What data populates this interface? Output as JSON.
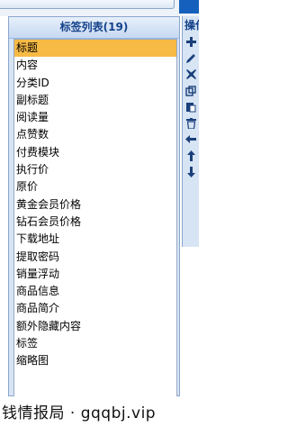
{
  "panel": {
    "title": "标签列表(19)",
    "items": [
      {
        "label": "标题",
        "selected": true
      },
      {
        "label": "内容"
      },
      {
        "label": "分类ID"
      },
      {
        "label": "副标题"
      },
      {
        "label": "阅读量"
      },
      {
        "label": "点赞数"
      },
      {
        "label": "付费模块"
      },
      {
        "label": "执行价"
      },
      {
        "label": "原价"
      },
      {
        "label": "黄金会员价格"
      },
      {
        "label": "钻石会员价格"
      },
      {
        "label": "下载地址"
      },
      {
        "label": "提取密码"
      },
      {
        "label": "销量浮动"
      },
      {
        "label": "商品信息"
      },
      {
        "label": "商品简介"
      },
      {
        "label": "额外隐藏内容"
      },
      {
        "label": "标签"
      },
      {
        "label": "缩略图"
      }
    ],
    "selected_color": "#f7ba45"
  },
  "ops": {
    "label": "操作",
    "icons": [
      "plus-icon",
      "pencil-icon",
      "delete-icon",
      "copy-icon",
      "paste-icon",
      "trash-icon",
      "arrow-left-icon",
      "arrow-up-icon",
      "arrow-down-icon"
    ]
  },
  "watermark": "钱情报局 · gqqbj.vip"
}
